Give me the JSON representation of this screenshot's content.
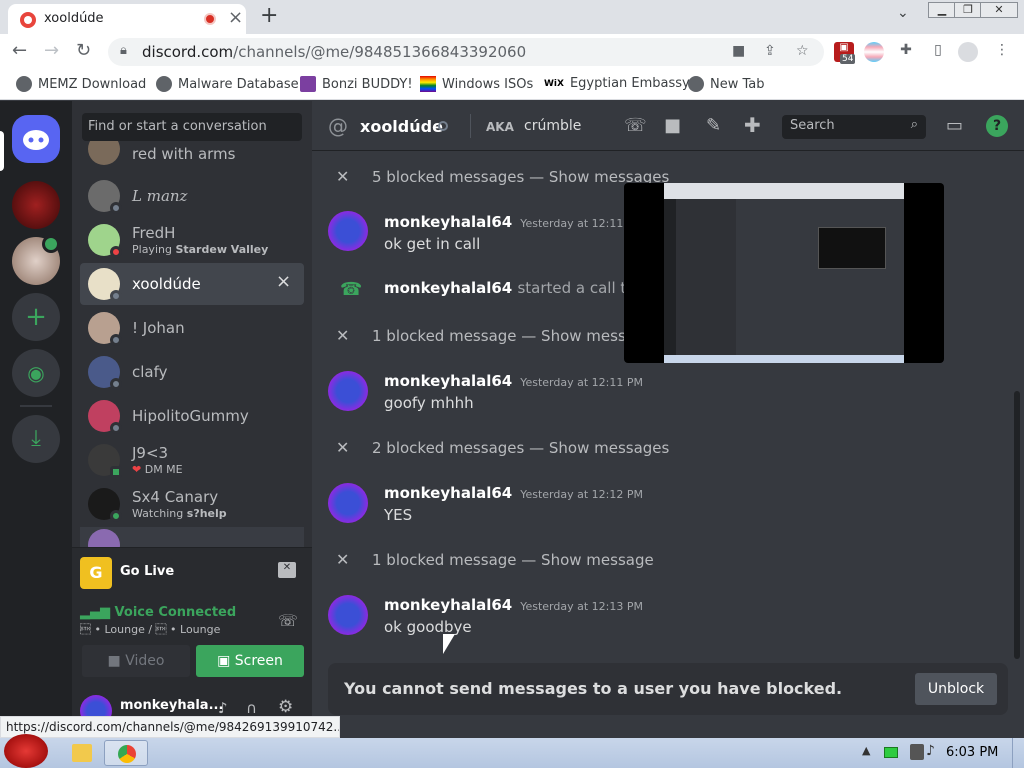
{
  "browser": {
    "tab_title": "xooldúde",
    "url_domain": "discord.com",
    "url_path": "/channels/@me/984851366843392060",
    "extension_badge": "54",
    "bookmarks": [
      "MEMZ Download",
      "Malware Database",
      "Bonzi BUDDY!",
      "Windows ISOs",
      "Egyptian Embassy",
      "New Tab"
    ],
    "status_url": "https://discord.com/channels/@me/984269139910742..."
  },
  "sidebar": {
    "search_placeholder": "Find or start a conversation",
    "dms": [
      {
        "name": "red with arms",
        "sub": ""
      },
      {
        "name": "L manz",
        "sub": ""
      },
      {
        "name": "FredH",
        "sub_prefix": "Playing ",
        "sub_bold": "Stardew Valley"
      },
      {
        "name": "xooldúde",
        "sub": "",
        "selected": true
      },
      {
        "name": "! Johan",
        "sub": ""
      },
      {
        "name": "clafy",
        "sub": ""
      },
      {
        "name": "HipolitoGummy",
        "sub": ""
      },
      {
        "name": "J9<3",
        "sub": "DM ME"
      },
      {
        "name": "Sx4 Canary",
        "sub_prefix": "Watching ",
        "sub_bold": "s?help"
      }
    ],
    "go_live": "Go Live",
    "voice_status": "Voice Connected",
    "voice_channel": "\u0002 • Lounge / \u0002 • Lounge",
    "video_label": "Video",
    "screen_label": "Screen",
    "user_name": "monkeyhala..."
  },
  "channel": {
    "name": "xooldúde",
    "aka_label": "AKA",
    "aka_value": "crúmble",
    "search_placeholder": "Search"
  },
  "messages": {
    "blocked_1": "5 blocked messages — Show messages",
    "m1_author": "monkeyhalal64",
    "m1_time": "Yesterday at 12:11 PM",
    "m1_text": "ok get in call",
    "call_author": "monkeyhalal64",
    "call_text": "started a call that las",
    "blocked_2": "1 blocked message — Show message",
    "m2_author": "monkeyhalal64",
    "m2_time": "Yesterday at 12:11 PM",
    "m2_text": "goofy mhhh",
    "blocked_3": "2 blocked messages — Show messages",
    "m3_author": "monkeyhalal64",
    "m3_time": "Yesterday at 12:12 PM",
    "m3_text": "YES",
    "blocked_4": "1 blocked message — Show message",
    "m4_author": "monkeyhalal64",
    "m4_time": "Yesterday at 12:13 PM",
    "m4_text": "ok goodbye"
  },
  "blockbar": {
    "text": "You cannot send messages to a user you have blocked.",
    "unblock": "Unblock"
  },
  "taskbar": {
    "clock": "6:03 PM"
  },
  "colors": {
    "discord_blurple": "#5865f2",
    "green": "#3ba55d",
    "bg": "#36393f"
  }
}
